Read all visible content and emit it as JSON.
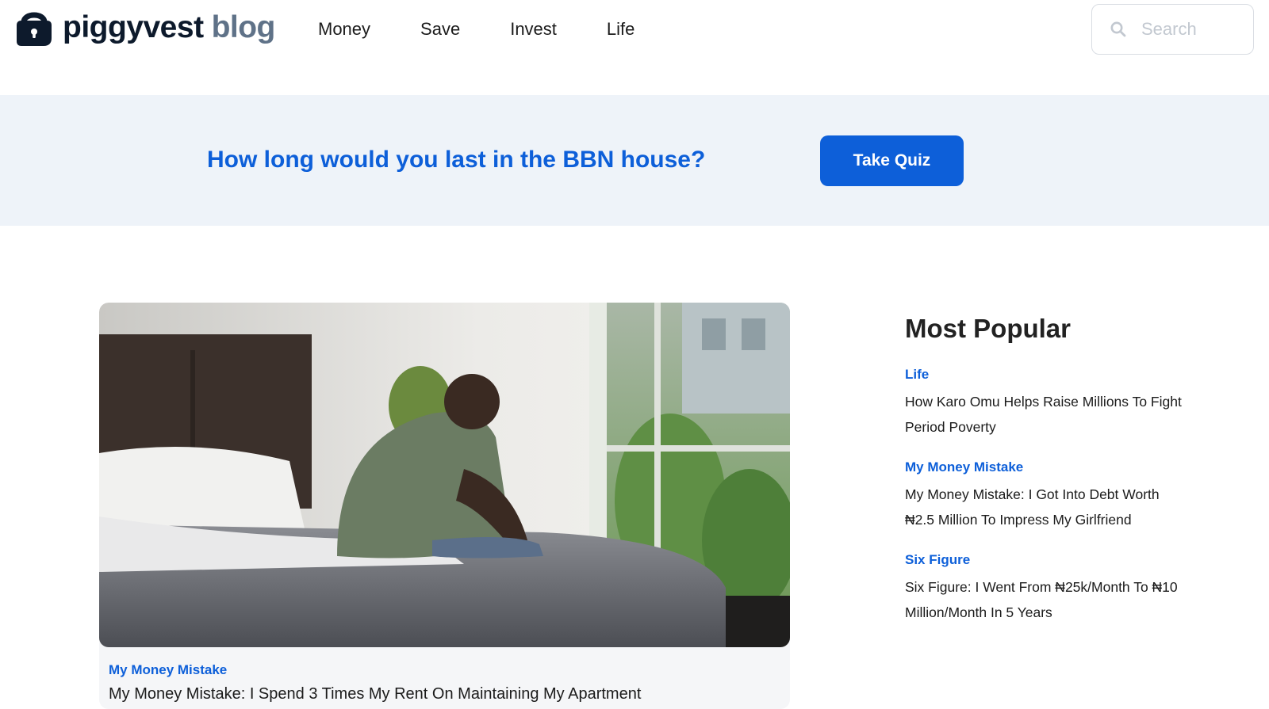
{
  "header": {
    "logo_brand": "piggyvest",
    "logo_suffix": "blog",
    "nav": [
      {
        "label": "Money"
      },
      {
        "label": "Save"
      },
      {
        "label": "Invest"
      },
      {
        "label": "Life"
      }
    ],
    "search": {
      "placeholder": "Search",
      "value": ""
    }
  },
  "banner": {
    "text": "How long would you last in the BBN house?",
    "button_label": "Take Quiz"
  },
  "featured": {
    "tag": "My Money Mistake",
    "title": "My Money Mistake: I Spend 3 Times My Rent On Maintaining My Apartment"
  },
  "sidebar": {
    "heading": "Most Popular",
    "items": [
      {
        "tag": "Life",
        "title": "How Karo Omu Helps Raise Millions To Fight Period Poverty"
      },
      {
        "tag": "My Money Mistake",
        "title": "My Money Mistake: I Got Into Debt Worth ₦2.5 Million To Impress My Girlfriend"
      },
      {
        "tag": "Six Figure",
        "title": "Six Figure: I Went From ₦25k/Month To ₦10 Million/Month In 5 Years"
      }
    ]
  },
  "colors": {
    "accent": "#0d5fd9",
    "banner_bg": "#eef3f9",
    "logo_dark": "#0d1a2c",
    "logo_muted": "#5f7288"
  },
  "icons": [
    "piggy-lock-logo-icon",
    "search-icon"
  ]
}
